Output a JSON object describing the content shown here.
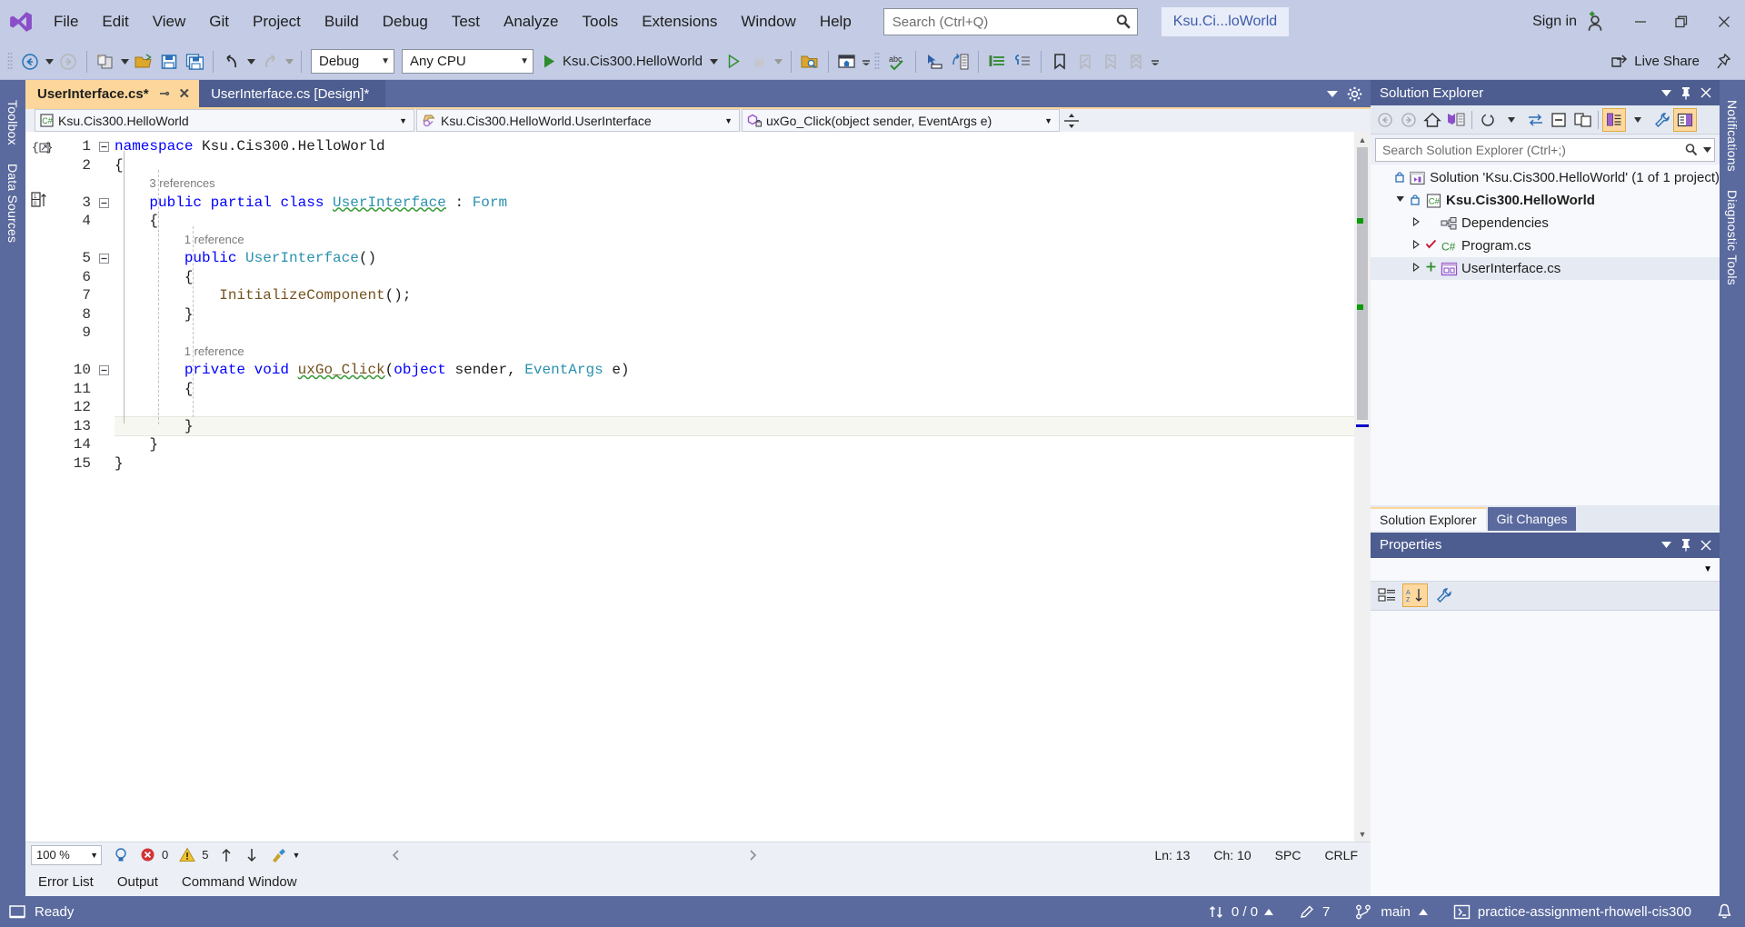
{
  "titlebar": {
    "logo_icon": "visual-studio-logo",
    "menus": [
      "File",
      "Edit",
      "View",
      "Git",
      "Project",
      "Build",
      "Debug",
      "Test",
      "Analyze",
      "Tools",
      "Extensions",
      "Window",
      "Help"
    ],
    "search_placeholder": "Search (Ctrl+Q)",
    "search_value": "",
    "search_icon": "search-icon",
    "project_chip": "Ksu.Ci...loWorld",
    "sign_in": "Sign in",
    "sign_in_icon": "add-user-icon",
    "minimize_icon": "minimize-icon",
    "maximize_icon": "restore-icon",
    "close_icon": "close-icon"
  },
  "toolbar": {
    "nav_back_icon": "navigate-back-icon",
    "nav_forward_icon": "navigate-forward-icon",
    "new_project_icon": "new-project-icon",
    "open_file_icon": "open-file-icon",
    "save_icon": "save-icon",
    "save_all_icon": "save-all-icon",
    "undo_icon": "undo-icon",
    "redo_icon": "redo-icon",
    "configuration": "Debug",
    "platform": "Any CPU",
    "run_target": "Ksu.Cis300.HelloWorld",
    "run_icon": "play-icon",
    "start_no_debug_icon": "play-outline-icon",
    "hot_reload_icon": "hot-reload-icon",
    "solution_explorer_search_icon": "folder-search-icon",
    "live_share_label": "Live Share",
    "live_share_icon": "live-share-icon",
    "pin_icon": "pin-icon",
    "icons_right": [
      "window-home-icon",
      "spell-check-icon",
      "pointer-select-icon",
      "indent-icon",
      "comment-icon",
      "uncomment-icon",
      "bookmark-icon",
      "prev-bookmark-icon",
      "next-bookmark-icon",
      "clear-bookmark-icon"
    ]
  },
  "left_rail": {
    "tabs": [
      "Toolbox",
      "Data Sources"
    ]
  },
  "right_rail": {
    "tabs": [
      "Notifications",
      "Diagnostic Tools"
    ]
  },
  "editor": {
    "tabs": [
      {
        "label": "UserInterface.cs*",
        "active": true,
        "pin_icon": "pin-icon",
        "close_icon": "close-icon"
      },
      {
        "label": "UserInterface.cs [Design]*",
        "active": false
      }
    ],
    "tabstrip_right_icons": [
      "chevron-down-icon",
      "gear-icon"
    ],
    "navbars": [
      {
        "icon": "csharp-project-icon",
        "text": "Ksu.Cis300.HelloWorld"
      },
      {
        "icon": "class-icon",
        "text": "Ksu.Cis300.HelloWorld.UserInterface"
      },
      {
        "icon": "private-method-icon",
        "text": "uxGo_Click(object sender, EventArgs e)"
      }
    ],
    "split_icon": "split-view-icon",
    "lines": [
      {
        "num": "1",
        "indent": 0,
        "fold": "minus",
        "tokens": [
          {
            "t": "namespace ",
            "c": "kw"
          },
          {
            "t": "Ksu.Cis300.HelloWorld",
            "c": "id"
          }
        ]
      },
      {
        "num": "2",
        "indent": 0,
        "tokens": [
          {
            "t": "{",
            "c": "id"
          }
        ]
      },
      {
        "num": "",
        "indent": 1,
        "reference": "3 references"
      },
      {
        "num": "3",
        "indent": 1,
        "fold": "minus",
        "tokens": [
          {
            "t": "public ",
            "c": "kw"
          },
          {
            "t": "partial ",
            "c": "kw"
          },
          {
            "t": "class ",
            "c": "kw"
          },
          {
            "t": "UserInterface",
            "c": "typ sq"
          },
          {
            "t": " : ",
            "c": "id"
          },
          {
            "t": "Form",
            "c": "typ"
          }
        ]
      },
      {
        "num": "4",
        "indent": 1,
        "tokens": [
          {
            "t": "{",
            "c": "id"
          }
        ]
      },
      {
        "num": "",
        "indent": 2,
        "reference": "1 reference"
      },
      {
        "num": "5",
        "indent": 2,
        "fold": "minus",
        "tokens": [
          {
            "t": "public ",
            "c": "kw"
          },
          {
            "t": "UserInterface",
            "c": "typ"
          },
          {
            "t": "()",
            "c": "id"
          }
        ]
      },
      {
        "num": "6",
        "indent": 2,
        "tokens": [
          {
            "t": "{",
            "c": "id"
          }
        ]
      },
      {
        "num": "7",
        "indent": 3,
        "tokens": [
          {
            "t": "InitializeComponent",
            "c": "mth"
          },
          {
            "t": "();",
            "c": "id"
          }
        ]
      },
      {
        "num": "8",
        "indent": 2,
        "tokens": [
          {
            "t": "}",
            "c": "id"
          }
        ]
      },
      {
        "num": "9",
        "indent": 0,
        "tokens": []
      },
      {
        "num": "",
        "indent": 2,
        "reference": "1 reference"
      },
      {
        "num": "10",
        "indent": 2,
        "fold": "minus",
        "tokens": [
          {
            "t": "private ",
            "c": "kw"
          },
          {
            "t": "void ",
            "c": "kw"
          },
          {
            "t": "uxGo_Click",
            "c": "mth sq"
          },
          {
            "t": "(",
            "c": "id"
          },
          {
            "t": "object ",
            "c": "kw"
          },
          {
            "t": "sender",
            "c": "id"
          },
          {
            "t": ", ",
            "c": "id"
          },
          {
            "t": "EventArgs",
            "c": "typ"
          },
          {
            "t": " e)",
            "c": "id"
          }
        ]
      },
      {
        "num": "11",
        "indent": 2,
        "tokens": [
          {
            "t": "{",
            "c": "id"
          }
        ]
      },
      {
        "num": "12",
        "indent": 0,
        "tokens": []
      },
      {
        "num": "13",
        "indent": 2,
        "current": true,
        "tokens": [
          {
            "t": "}",
            "c": "id"
          }
        ]
      },
      {
        "num": "14",
        "indent": 1,
        "tokens": [
          {
            "t": "}",
            "c": "id"
          }
        ]
      },
      {
        "num": "15",
        "indent": 0,
        "tokens": [
          {
            "t": "}",
            "c": "id"
          }
        ]
      }
    ],
    "status": {
      "zoom": "100 %",
      "error_icon": "error-icon",
      "error_count": "0",
      "warning_icon": "warning-icon",
      "warning_count": "5",
      "up_icon": "arrow-up-icon",
      "down_icon": "arrow-down-icon",
      "broom_icon": "code-cleanup-icon",
      "line": "Ln: 13",
      "char": "Ch: 10",
      "spaces": "SPC",
      "line_ending": "CRLF"
    },
    "bottom_tabs": [
      "Error List",
      "Output",
      "Command Window"
    ]
  },
  "solution_explorer": {
    "title": "Solution Explorer",
    "header_icons": [
      "chevron-down-icon",
      "pin-icon",
      "close-icon"
    ],
    "toolbar_icons": [
      "back-icon",
      "forward-icon",
      "home-icon",
      "pending-changes-icon",
      "sync-views-icon",
      "refresh-icon",
      "collapse-all-icon",
      "show-all-files-icon",
      "properties-window-icon",
      "view-code-icon",
      "wrench-icon",
      "preview-selected-icon"
    ],
    "search_placeholder": "Search Solution Explorer (Ctrl+;)",
    "search_value": "",
    "search_icon": "search-icon",
    "tree": [
      {
        "label": "Solution 'Ksu.Cis300.HelloWorld' (1 of 1 project)",
        "depth": 0,
        "expander": "",
        "lock_icon": "lock-icon",
        "icon": "solution-icon",
        "bold": false,
        "selected": false
      },
      {
        "label": "Ksu.Cis300.HelloWorld",
        "depth": 1,
        "expander": "expanded",
        "lock_icon": "lock-icon",
        "icon": "csharp-project-icon",
        "bold": true,
        "selected": false
      },
      {
        "label": "Dependencies",
        "depth": 2,
        "expander": "collapsed",
        "lock_icon": "",
        "icon": "dependencies-icon",
        "bold": false,
        "selected": false
      },
      {
        "label": "Program.cs",
        "depth": 2,
        "expander": "collapsed",
        "lock_icon": "check-icon",
        "icon": "csharp-file-icon",
        "bold": false,
        "selected": false
      },
      {
        "label": "UserInterface.cs",
        "depth": 2,
        "expander": "collapsed",
        "lock_icon": "plus-icon",
        "icon": "form-icon",
        "bold": false,
        "selected": true
      }
    ],
    "tabs": [
      {
        "label": "Solution Explorer",
        "active": true
      },
      {
        "label": "Git Changes",
        "active": false
      }
    ]
  },
  "properties": {
    "title": "Properties",
    "header_icons": [
      "chevron-down-icon",
      "pin-icon",
      "close-icon"
    ],
    "selector_value": "",
    "toolbar_icons": [
      "categorized-icon",
      "alphabetical-icon",
      "properties-icon"
    ]
  },
  "statusbar": {
    "status_icon": "ready-icon",
    "ready": "Ready",
    "source_control_icon": "sync-icon",
    "sync_counts": "0 / 0",
    "sync_arrow": "caret-up-icon",
    "pencil_icon": "pencil-icon",
    "pending_changes": "7",
    "branch_icon": "branch-icon",
    "branch": "main",
    "repo_icon": "repository-icon",
    "repo": "practice-assignment-rhowell-cis300",
    "notify_icon": "notification-bell-icon"
  },
  "colors": {
    "chrome": "#c3cce4",
    "panel_header": "#4d5d90",
    "status_bar": "#5a6a9e",
    "active_tab": "#fcd69a",
    "accent_blue": "#0000ff",
    "type_teal": "#2b91af",
    "method_brown": "#74531f"
  }
}
